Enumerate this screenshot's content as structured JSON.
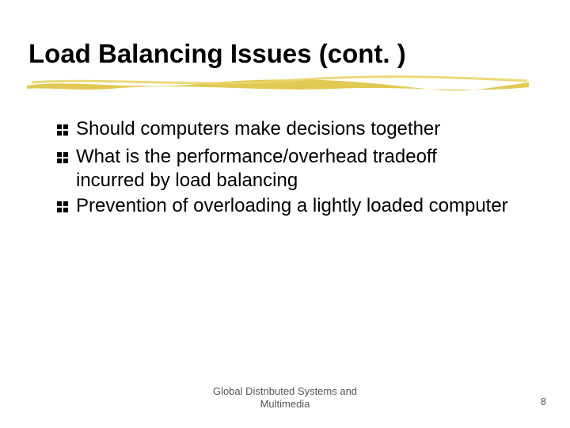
{
  "title": "Load Balancing Issues (cont. )",
  "underline_color": "#e0c64a",
  "bullets": [
    "Should computers make decisions together",
    "What is the performance/overhead tradeoff incurred by load balancing",
    "Prevention of overloading a lightly loaded computer"
  ],
  "footer": {
    "line1": "Global Distributed Systems and",
    "line2": "Multimedia"
  },
  "page_number": "8",
  "bullet_icon_color": "#000000"
}
